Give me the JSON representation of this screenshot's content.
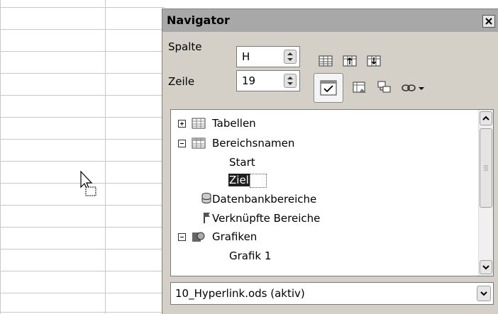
{
  "navigator": {
    "title": "Navigator",
    "column_label": "Spalte",
    "column_value": "H",
    "row_label": "Zeile",
    "row_value": "19"
  },
  "tree": {
    "items": [
      {
        "label": "Tabellen"
      },
      {
        "label": "Bereichsnamen"
      },
      {
        "label": "Start"
      },
      {
        "label": "Ziel"
      },
      {
        "label": "Datenbankbereiche"
      },
      {
        "label": "Verknüpfte Bereiche"
      },
      {
        "label": "Grafiken"
      },
      {
        "label": "Grafik 1"
      }
    ]
  },
  "document_select": {
    "value": "10_Hyperlink.ods (aktiv)"
  },
  "icons": {
    "close": "close-icon",
    "data_area": "data-area-icon",
    "start": "start-icon",
    "end": "end-icon",
    "contents": "contents-toggle-icon",
    "scenarios": "scenarios-icon",
    "drag_mode": "drag-mode-icon",
    "link": "link-icon"
  }
}
